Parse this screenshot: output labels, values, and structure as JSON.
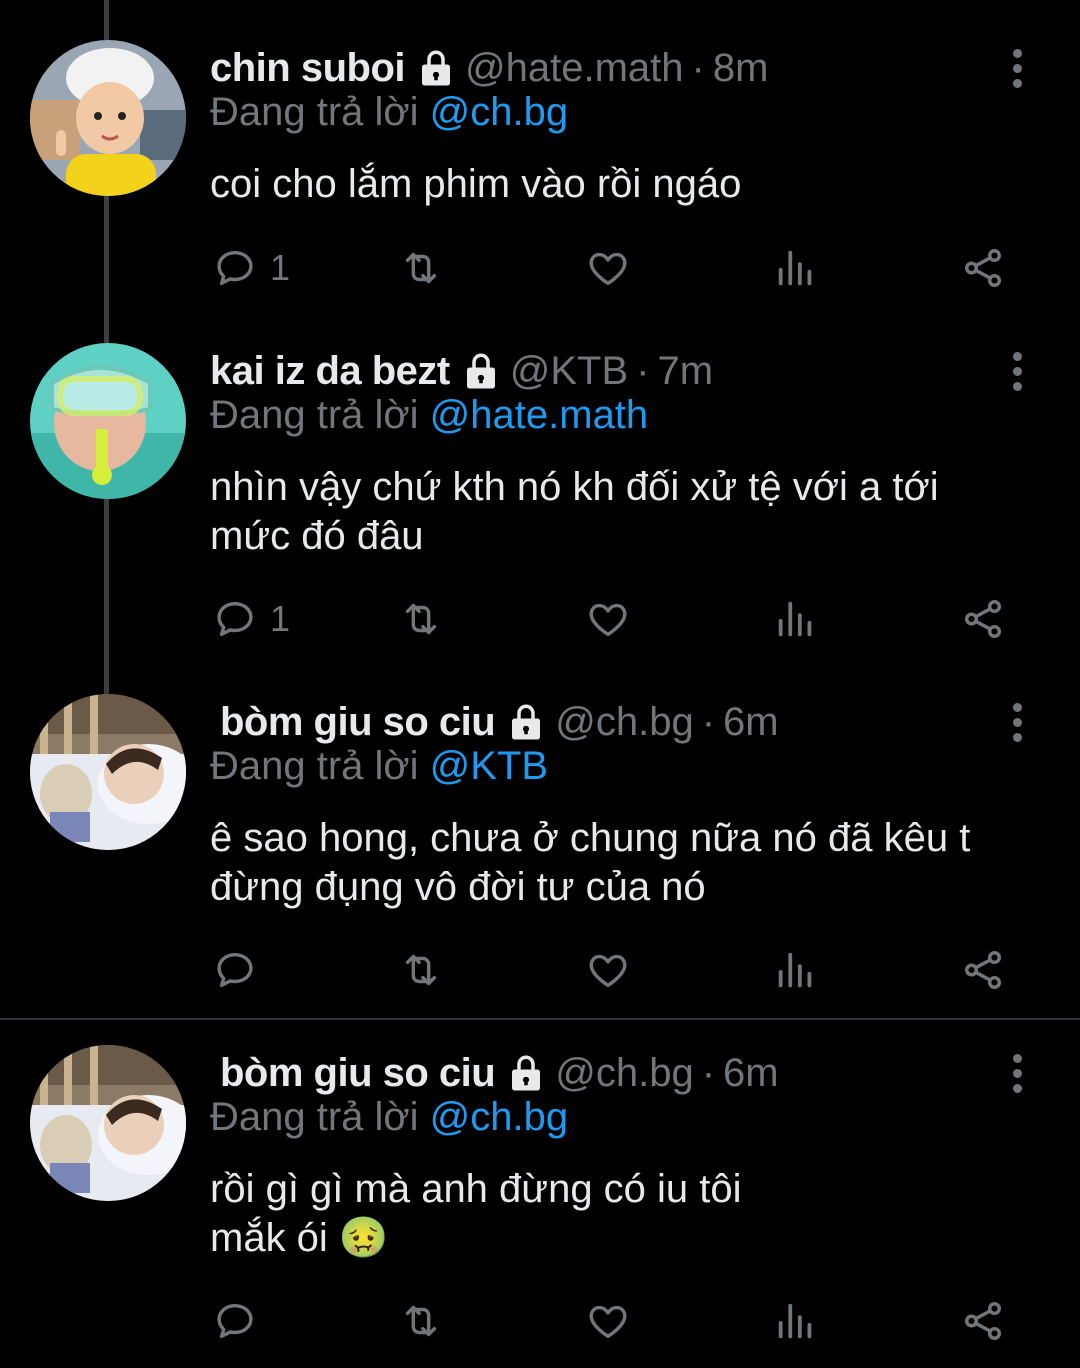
{
  "reply_prefix": "Đang trả lời",
  "tweets": [
    {
      "name": "chin suboi",
      "handle": "@hate.math",
      "time": "8m",
      "reply_to": "@ch.bg",
      "lines": [
        "coi cho lắm phim vào rồi ngáo"
      ],
      "reply_count": "1"
    },
    {
      "name": "kai iz da bezt",
      "handle": "@KTB",
      "time": "7m",
      "reply_to": "@hate.math",
      "lines": [
        "nhìn vậy chứ kth nó kh đối xử tệ với a tới",
        "mức đó đâu"
      ],
      "reply_count": "1"
    },
    {
      "name": "bòm giu so ciu",
      "handle": "@ch.bg",
      "time": "6m",
      "reply_to": "@KTB",
      "lines": [
        "ê sao hong, chưa ở chung nữa nó đã kêu t",
        "đừng đụng vô đời tư của nó"
      ],
      "reply_count": ""
    },
    {
      "name": "bòm giu so ciu",
      "handle": "@ch.bg",
      "time": "6m",
      "reply_to": "@ch.bg",
      "lines": [
        "rồi gì gì mà anh đừng có iu tôi",
        "mắk ói 🤢"
      ],
      "reply_count": ""
    }
  ],
  "colors": {
    "background": "#000000",
    "text": "#e7e9ea",
    "muted": "#71767b",
    "mention": "#1d9bf0"
  }
}
